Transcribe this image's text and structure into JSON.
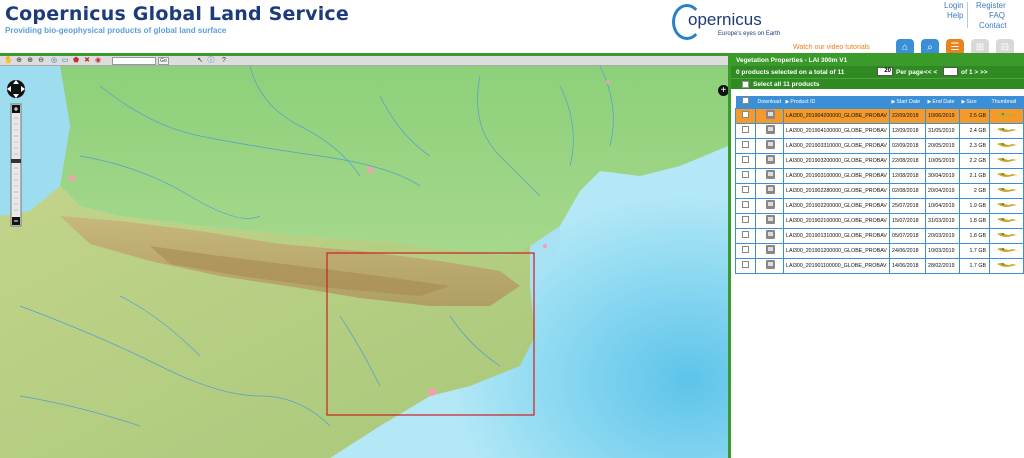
{
  "header": {
    "title": "Copernicus Global Land Service",
    "subtitle": "Providing bio-geophysical products of global land surface",
    "logo_word": "opernicus",
    "logo_tagline": "Europe's eyes on Earth",
    "video_link": "Watch our video tutorials",
    "links": {
      "login": "Login",
      "help": "Help",
      "register": "Register",
      "faq": "FAQ",
      "contact": "Contact"
    }
  },
  "toolbar": {
    "go_label": "Go",
    "help_icon": "?"
  },
  "panel": {
    "title": "Vegetation Properties - LAI 300m V1",
    "selection_summary": "0 products selected on a total of 11",
    "per_page_value": "20",
    "per_page_label": "Per page",
    "pager_prev": "<< <",
    "page_of": "of 1 > >>",
    "select_all_label": "Select all 11 products",
    "columns": {
      "download": "Download",
      "product_id": "Product ID",
      "start": "Start Date",
      "end": "End Date",
      "size": "Size",
      "thumbnail": "Thumbnail"
    },
    "rows": [
      {
        "id": "LAI300_201904200000_GLOBE_PROBAV",
        "start": "22/09/2018",
        "end": "10/06/2019",
        "size": "2.5 GB",
        "selected": true
      },
      {
        "id": "LAI300_201904100000_GLOBE_PROBAV",
        "start": "12/09/2018",
        "end": "31/05/2019",
        "size": "2.4 GB",
        "selected": false
      },
      {
        "id": "LAI300_201903310000_GLOBE_PROBAV",
        "start": "02/09/2018",
        "end": "20/05/2019",
        "size": "2.3 GB",
        "selected": false
      },
      {
        "id": "LAI300_201903200000_GLOBE_PROBAV",
        "start": "22/08/2018",
        "end": "10/05/2019",
        "size": "2.2 GB",
        "selected": false
      },
      {
        "id": "LAI300_201903100000_GLOBE_PROBAV",
        "start": "12/08/2018",
        "end": "30/04/2019",
        "size": "2.1 GB",
        "selected": false
      },
      {
        "id": "LAI300_201902280000_GLOBE_PROBAV",
        "start": "02/08/2018",
        "end": "20/04/2019",
        "size": "2 GB",
        "selected": false
      },
      {
        "id": "LAI300_201902200000_GLOBE_PROBAV",
        "start": "25/07/2018",
        "end": "10/04/2019",
        "size": "1.9 GB",
        "selected": false
      },
      {
        "id": "LAI300_201902100000_GLOBE_PROBAV",
        "start": "15/07/2018",
        "end": "31/03/2019",
        "size": "1.8 GB",
        "selected": false
      },
      {
        "id": "LAI300_201901310000_GLOBE_PROBAV",
        "start": "05/07/2018",
        "end": "20/03/2019",
        "size": "1.8 GB",
        "selected": false
      },
      {
        "id": "LAI300_201901200000_GLOBE_PROBAV",
        "start": "24/06/2018",
        "end": "10/03/2019",
        "size": "1.7 GB",
        "selected": false
      },
      {
        "id": "LAI300_201901100000_GLOBE_PROBAV",
        "start": "14/06/2018",
        "end": "28/02/2019",
        "size": "1.7 GB",
        "selected": false
      }
    ]
  },
  "colors": {
    "brand_green": "#3a9a2a",
    "table_blue": "#3a8fd6",
    "selected_orange": "#f39a2a",
    "title_navy": "#1d3b7a"
  }
}
